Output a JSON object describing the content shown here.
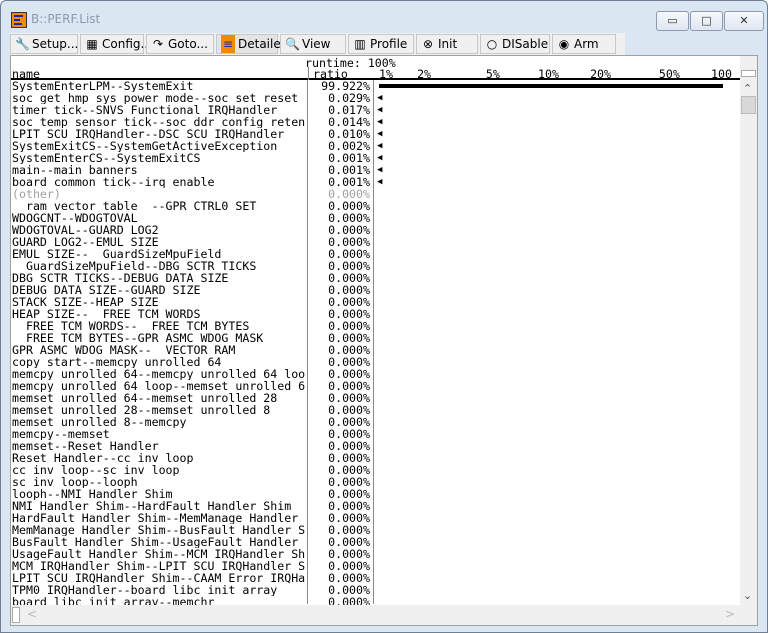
{
  "window": {
    "title": "B::PERF.List",
    "minimize": "▭",
    "maximize": "□",
    "close": "✕"
  },
  "toolbar": [
    {
      "label": "Setup...",
      "icon": "wrench-icon",
      "glyph": "🔧"
    },
    {
      "label": "Config...",
      "icon": "grid-icon",
      "glyph": "▦"
    },
    {
      "label": "Goto...",
      "icon": "goto-arrow-icon",
      "glyph": "↷"
    },
    {
      "label": "Detailed",
      "icon": "detailed-list-icon",
      "glyph": "≡"
    },
    {
      "label": "View",
      "icon": "magnifier-icon",
      "glyph": "🔍"
    },
    {
      "label": "Profile",
      "icon": "profile-chart-icon",
      "glyph": "▥"
    },
    {
      "label": "Init",
      "icon": "init-circle-x-icon",
      "glyph": "⊗"
    },
    {
      "label": "DISable",
      "icon": "disable-circle-icon",
      "glyph": "○"
    },
    {
      "label": "Arm",
      "icon": "arm-radio-icon",
      "glyph": "◉"
    }
  ],
  "header": {
    "runtime": "runtime: 100%",
    "name": "name",
    "ratio": "ratio"
  },
  "chart_data": {
    "type": "bar",
    "scale": "log",
    "xlim": [
      1,
      100
    ],
    "ticks": [
      "1%",
      "2%",
      "5%",
      "10%",
      "20%",
      "50%",
      "100"
    ],
    "tick_values": [
      1,
      2,
      5,
      10,
      20,
      50,
      100
    ]
  },
  "rows": [
    {
      "name": "SystemEnterLPM--SystemExit",
      "ratio": "99.922%",
      "value": 99.922
    },
    {
      "name": "soc_get_hmp_sys_power_mode--soc_set_reset_",
      "ratio": "0.029%",
      "value": 0.029
    },
    {
      "name": "timer_tick--SNVS_Functional_IRQHandler",
      "ratio": "0.017%",
      "value": 0.017
    },
    {
      "name": "soc_temp_sensor_tick--soc_ddr_config_reten",
      "ratio": "0.014%",
      "value": 0.014
    },
    {
      "name": "LPIT_SCU_IRQHandler--DSC_SCU_IRQHandler",
      "ratio": "0.010%",
      "value": 0.01
    },
    {
      "name": "SystemExitCS--SystemGetActiveException",
      "ratio": "0.002%",
      "value": 0.002
    },
    {
      "name": "SystemEnterCS--SystemExitCS",
      "ratio": "0.001%",
      "value": 0.001
    },
    {
      "name": "main--main_banners",
      "ratio": "0.001%",
      "value": 0.001
    },
    {
      "name": "board_common_tick--irq_enable",
      "ratio": "0.001%",
      "value": 0.001
    },
    {
      "name": "(other)",
      "ratio": "0.000%",
      "value": 0,
      "other": true
    },
    {
      "name": "__ram_vector_table__--GPR_CTRL0_SET",
      "ratio": "0.000%",
      "value": 0
    },
    {
      "name": "WDOGCNT--WDOGTOVAL",
      "ratio": "0.000%",
      "value": 0
    },
    {
      "name": "WDOGTOVAL--GUARD_LOG2",
      "ratio": "0.000%",
      "value": 0
    },
    {
      "name": "GUARD_LOG2--EMUL_SIZE",
      "ratio": "0.000%",
      "value": 0
    },
    {
      "name": "EMUL_SIZE--__GuardSizeMpuField",
      "ratio": "0.000%",
      "value": 0
    },
    {
      "name": "__GuardSizeMpuField--DBG_SCTR_TICKS",
      "ratio": "0.000%",
      "value": 0
    },
    {
      "name": "DBG_SCTR_TICKS--DEBUG_DATA_SIZE",
      "ratio": "0.000%",
      "value": 0
    },
    {
      "name": "DEBUG_DATA_SIZE--GUARD_SIZE",
      "ratio": "0.000%",
      "value": 0
    },
    {
      "name": "STACK_SIZE--HEAP_SIZE",
      "ratio": "0.000%",
      "value": 0
    },
    {
      "name": "HEAP_SIZE--__FREE_TCM_WORDS",
      "ratio": "0.000%",
      "value": 0
    },
    {
      "name": "__FREE_TCM_WORDS--__FREE_TCM_BYTES",
      "ratio": "0.000%",
      "value": 0
    },
    {
      "name": "__FREE_TCM_BYTES--GPR_ASMC_WDOG_MASK",
      "ratio": "0.000%",
      "value": 0
    },
    {
      "name": "GPR_ASMC_WDOG_MASK--__VECTOR_RAM",
      "ratio": "0.000%",
      "value": 0
    },
    {
      "name": "copy_start--memcpy_unrolled_64",
      "ratio": "0.000%",
      "value": 0
    },
    {
      "name": "memcpy_unrolled_64--memcpy_unrolled_64_loo",
      "ratio": "0.000%",
      "value": 0
    },
    {
      "name": "memcpy_unrolled_64_loop--memset_unrolled_6",
      "ratio": "0.000%",
      "value": 0
    },
    {
      "name": "memset_unrolled_64--memset_unrolled_28",
      "ratio": "0.000%",
      "value": 0
    },
    {
      "name": "memset_unrolled_28--memset_unrolled_8",
      "ratio": "0.000%",
      "value": 0
    },
    {
      "name": "memset_unrolled_8--memcpy",
      "ratio": "0.000%",
      "value": 0
    },
    {
      "name": "memcpy--memset",
      "ratio": "0.000%",
      "value": 0
    },
    {
      "name": "memset--Reset_Handler",
      "ratio": "0.000%",
      "value": 0
    },
    {
      "name": "Reset_Handler--cc_inv_loop",
      "ratio": "0.000%",
      "value": 0
    },
    {
      "name": "cc_inv_loop--sc_inv_loop",
      "ratio": "0.000%",
      "value": 0
    },
    {
      "name": "sc_inv_loop--looph",
      "ratio": "0.000%",
      "value": 0
    },
    {
      "name": "looph--NMI_Handler_Shim",
      "ratio": "0.000%",
      "value": 0
    },
    {
      "name": "NMI_Handler_Shim--HardFault_Handler_Shim",
      "ratio": "0.000%",
      "value": 0
    },
    {
      "name": "HardFault_Handler_Shim--MemManage_Handler_",
      "ratio": "0.000%",
      "value": 0
    },
    {
      "name": "MemManage_Handler_Shim--BusFault_Handler_S",
      "ratio": "0.000%",
      "value": 0
    },
    {
      "name": "BusFault_Handler_Shim--UsageFault_Handler_",
      "ratio": "0.000%",
      "value": 0
    },
    {
      "name": "UsageFault_Handler_Shim--MCM_IRQHandler_Sh",
      "ratio": "0.000%",
      "value": 0
    },
    {
      "name": "MCM_IRQHandler_Shim--LPIT_SCU_IRQHandler_S",
      "ratio": "0.000%",
      "value": 0
    },
    {
      "name": "LPIT_SCU_IRQHandler_Shim--CAAM_Error_IRQHa",
      "ratio": "0.000%",
      "value": 0
    },
    {
      "name": "TPM0_IRQHandler--board_libc_init_array",
      "ratio": "0.000%",
      "value": 0
    },
    {
      "name": "board_libc_init_array--memchr",
      "ratio": "0.000%",
      "value": 0
    }
  ],
  "scroll": {
    "up": "⌃",
    "down": "⌄",
    "left": "<",
    "right": ">"
  }
}
